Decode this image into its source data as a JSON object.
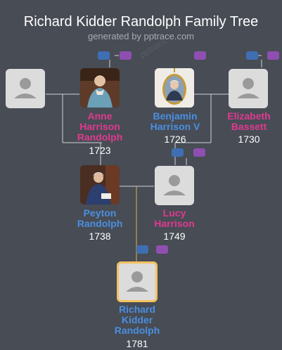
{
  "header": {
    "title": "Richard Kidder Randolph Family Tree",
    "subtitle": "generated by pptrace.com",
    "watermark": "pptrace"
  },
  "people": {
    "unknown_left": {
      "portrait": "placeholder"
    },
    "anne": {
      "name_lines": [
        "Anne",
        "Harrison",
        "Randolph"
      ],
      "year": "1723",
      "gender": "female",
      "portrait": "painting"
    },
    "benjamin": {
      "name_lines": [
        "Benjamin",
        "Harrison V"
      ],
      "year": "1726",
      "gender": "male",
      "portrait": "miniature"
    },
    "elizabeth": {
      "name_lines": [
        "Elizabeth",
        "Bassett"
      ],
      "year": "1730",
      "gender": "female",
      "portrait": "placeholder"
    },
    "peyton": {
      "name_lines": [
        "Peyton",
        "Randolph"
      ],
      "year": "1738",
      "gender": "male",
      "portrait": "painting"
    },
    "lucy": {
      "name_lines": [
        "Lucy",
        "Harrison"
      ],
      "year": "1749",
      "gender": "female",
      "portrait": "placeholder"
    },
    "richard": {
      "name_lines": [
        "Richard",
        "Kidder",
        "Randolph"
      ],
      "year": "1781",
      "gender": "male",
      "portrait": "placeholder",
      "selected": true
    }
  },
  "colors": {
    "background": "#474c55",
    "male": "#4a8fe0",
    "female": "#e0398f",
    "selected_border": "#f3c15f",
    "couple_button_blue": "#3f6fb2",
    "couple_button_purple": "#8f4fb0"
  },
  "icons": [
    "person-placeholder-icon",
    "couple-expand-button"
  ]
}
